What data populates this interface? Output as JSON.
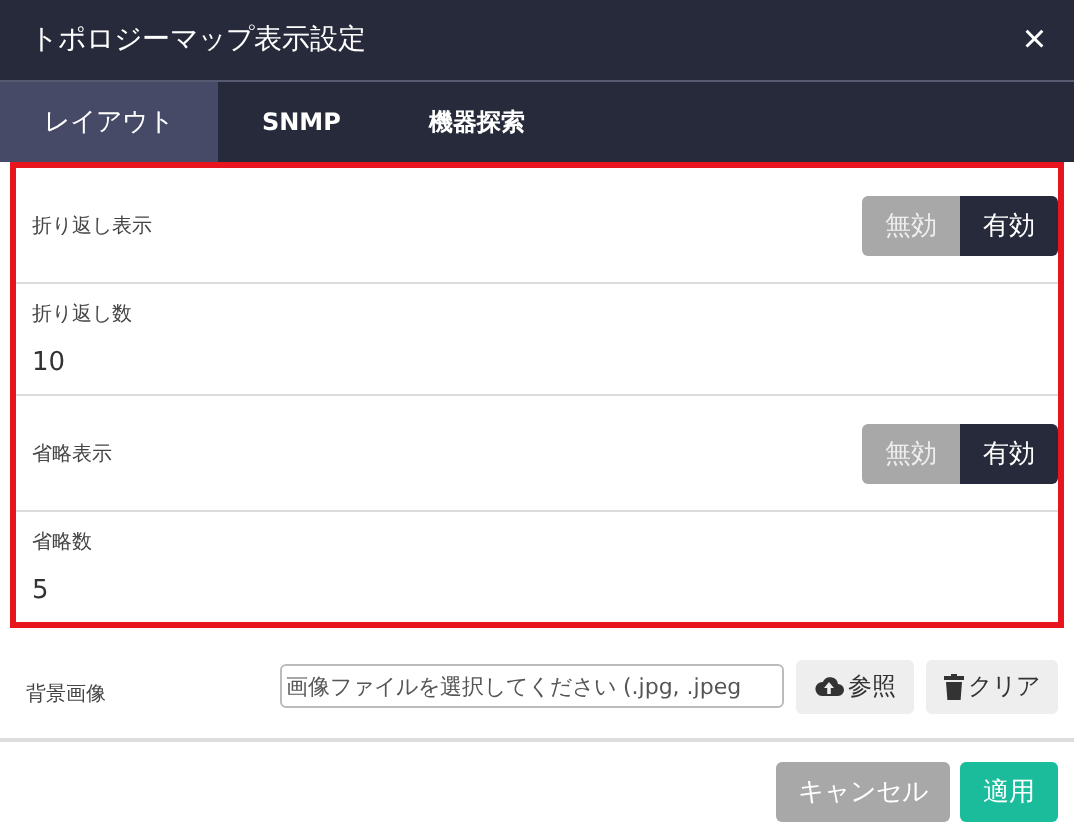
{
  "window": {
    "title": "トポロジーマップ表示設定",
    "close": "×"
  },
  "tabs": [
    {
      "label": "レイアウト",
      "selected": true
    },
    {
      "label": "SNMP",
      "selected": false
    },
    {
      "label": "機器探索",
      "selected": false
    }
  ],
  "settings": [
    {
      "kind": "toggle",
      "label": "折り返し表示",
      "options": [
        {
          "label": "無効",
          "selected": false
        },
        {
          "label": "有効",
          "selected": true
        }
      ]
    },
    {
      "kind": "number",
      "label": "折り返し数",
      "value": "10"
    },
    {
      "kind": "toggle",
      "label": "省略表示",
      "options": [
        {
          "label": "無効",
          "selected": false
        },
        {
          "label": "有効",
          "selected": true
        }
      ]
    },
    {
      "kind": "number",
      "label": "省略数",
      "value": "5"
    }
  ],
  "background_image": {
    "label": "背景画像",
    "placeholder": "画像ファイルを選択してください (.jpg, .jpeg",
    "browse": "参照",
    "clear": "クリア"
  },
  "buttons": [
    {
      "label": "キャンセル",
      "kind": "cancel"
    },
    {
      "label": "適用",
      "kind": "primary"
    }
  ]
}
